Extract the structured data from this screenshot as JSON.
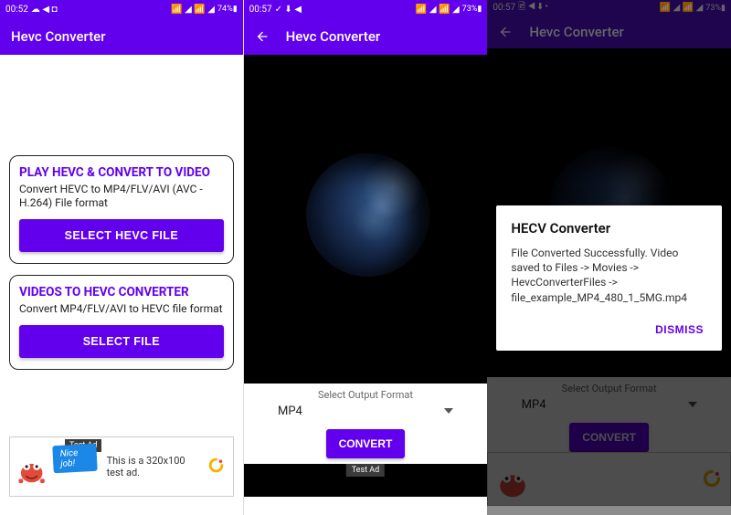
{
  "screen1": {
    "statusbar": {
      "time": "00:52",
      "left_icons": "☁ ◀ ◘",
      "right_icons": "📶 ◢ 📶 ◢",
      "battery": "74%▮"
    },
    "appbar": {
      "title": "Hevc Converter"
    },
    "card1": {
      "title": "PLAY HEVC & CONVERT TO VIDEO",
      "subtitle": "Convert HEVC to MP4/FLV/AVI (AVC - H.264) File format",
      "button": "SELECT HEVC FILE"
    },
    "card2": {
      "title": "VIDEOS TO HEVC CONVERTER",
      "subtitle": "Convert MP4/FLV/AVI to HEVC  file format",
      "button": "SELECT FILE"
    },
    "ad": {
      "badge": "Test Ad",
      "bubble": "Nice job!",
      "text": "This is a 320x100 test ad."
    }
  },
  "screen2": {
    "statusbar": {
      "time": "00:57",
      "left_icons": "✓ ⬇ ◀",
      "right_icons": "📶 ◢ 📶 ◢",
      "battery": "73%▮"
    },
    "appbar": {
      "title": "Hevc Converter"
    },
    "controls": {
      "label": "Select Output Format",
      "selected": "MP4",
      "button": "CONVERT"
    },
    "ad": {
      "badge": "Test Ad"
    }
  },
  "screen3": {
    "statusbar": {
      "time": "00:57",
      "left_icons": "🖻 ◀ ⬇ •",
      "right_icons": "📶 ◢ 📶 ◢",
      "battery": "73%▮"
    },
    "appbar": {
      "title": "Hevc Converter"
    },
    "controls": {
      "label": "Select Output Format",
      "selected": "MP4",
      "button": "CONVERT"
    },
    "dialog": {
      "title": "HECV Converter",
      "message": "File Converted Successfully. Video saved to\nFiles -> Movies -> HevcConverterFiles -> file_example_MP4_480_1_5MG.mp4",
      "dismiss": "DISMISS"
    }
  }
}
